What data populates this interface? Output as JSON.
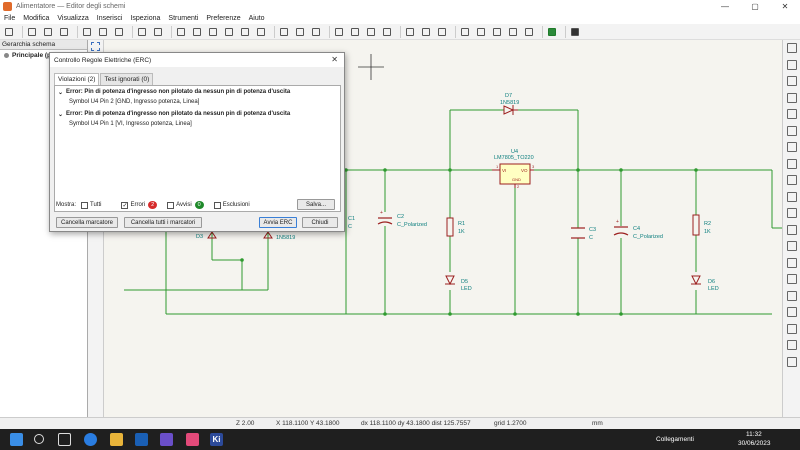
{
  "window": {
    "title": "Alimentatore — Editor degli schemi",
    "controls": [
      "—",
      "▢",
      "✕"
    ]
  },
  "menu": [
    "File",
    "Modifica",
    "Visualizza",
    "Inserisci",
    "Ispeziona",
    "Strumenti",
    "Preferenze",
    "Aiuto"
  ],
  "hierarchy": {
    "header": "Gerarchia schema",
    "root": "Principale (p"
  },
  "dialog": {
    "title": "Controllo Regole Elettriche (ERC)",
    "close": "✕",
    "tabs": [
      "Violazioni (2)",
      "Test ignorati (0)"
    ],
    "violations": [
      {
        "error": "Error: Pin di potenza d'ingresso non pilotato da nessun pin di potenza d'uscita",
        "detail": "Symbol U4 Pin 2 [GND, Ingresso potenza, Linea]"
      },
      {
        "error": "Error: Pin di potenza d'ingresso non pilotato da nessun pin di potenza d'uscita",
        "detail": "Symbol U4 Pin 1 [VI, Ingresso potenza, Linea]"
      }
    ],
    "show_label": "Mostra:",
    "filters": {
      "all": "Tutti",
      "errors": "Errori",
      "errors_count": "2",
      "warnings": "Avvisi",
      "warnings_count": "0",
      "exclusions": "Esclusioni"
    },
    "save": "Salva...",
    "clear_marker": "Cancella marcatore",
    "clear_all": "Cancella tutti i marcatori",
    "run": "Avvia ERC",
    "close_btn": "Chiudi"
  },
  "schematic": {
    "u4_ref": "U4",
    "u4_val": "LM7805_TO220",
    "d7_ref": "D7",
    "d7_val": "1N5819",
    "d4_val": "1N5819",
    "d3_ref": "D3",
    "c1_ref": "C1",
    "c1_val": "C",
    "c2_ref": "C2",
    "c2_val": "C_Polarized",
    "r1_ref": "R1",
    "r1_val": "1K",
    "d5_ref": "D5",
    "d5_val": "LED",
    "c3_ref": "C3",
    "c3_val": "C",
    "c4_ref": "C4",
    "c4_val": "C_Polarized",
    "r2_ref": "R2",
    "r2_val": "1K",
    "d6_ref": "D6",
    "d6_val": "LED",
    "vi": "VI",
    "vo": "VO",
    "gnd": "GND",
    "pin1": "1",
    "pin3": "3",
    "pin2": "2"
  },
  "status": {
    "zoom": "Z 2.00",
    "xy": "X 118.1100  Y 43.1800",
    "dxdy": "dx 118.1100  dy 43.1800  dist 125.7557",
    "grid": "grid 1.2700",
    "units": "mm"
  },
  "taskbar": {
    "network": "Collegamenti",
    "time": "11:32",
    "date": "30/06/2023"
  },
  "colors": {
    "wire": "#2f9a2f",
    "component": "#9c1f1f",
    "label": "#0b7e7e",
    "canvas": "#f5f4ef",
    "error_badge": "#d62b2b",
    "warning_badge": "#1f8a2a"
  }
}
